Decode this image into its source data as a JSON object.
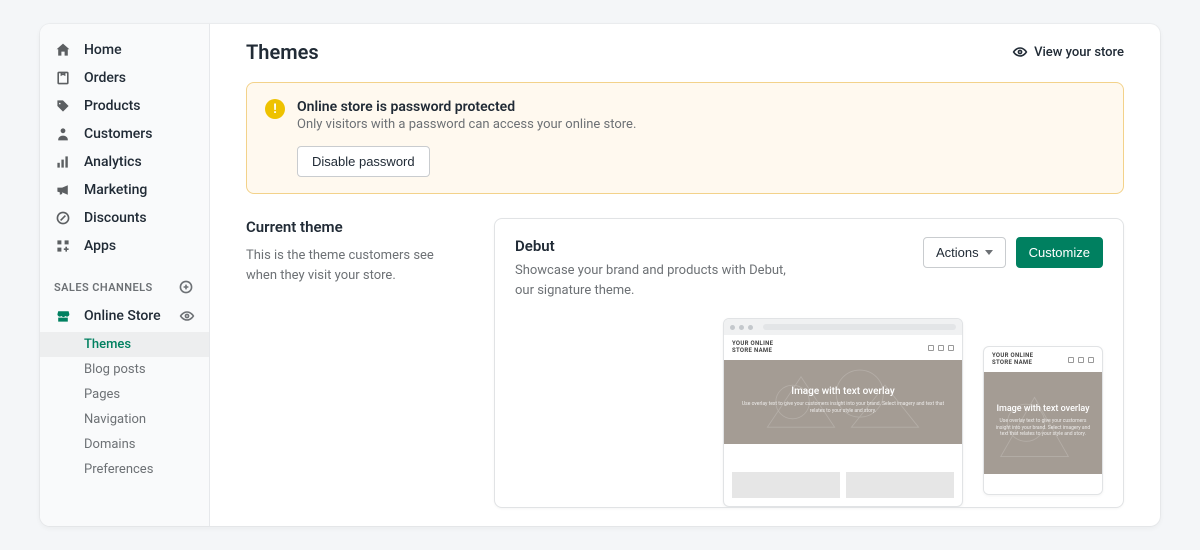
{
  "sidebar": {
    "items": [
      {
        "label": "Home"
      },
      {
        "label": "Orders"
      },
      {
        "label": "Products"
      },
      {
        "label": "Customers"
      },
      {
        "label": "Analytics"
      },
      {
        "label": "Marketing"
      },
      {
        "label": "Discounts"
      },
      {
        "label": "Apps"
      }
    ],
    "channels_heading": "SALES CHANNELS",
    "channel": {
      "label": "Online Store"
    },
    "sub_items": [
      {
        "label": "Themes",
        "active": true
      },
      {
        "label": "Blog posts"
      },
      {
        "label": "Pages"
      },
      {
        "label": "Navigation"
      },
      {
        "label": "Domains"
      },
      {
        "label": "Preferences"
      }
    ]
  },
  "header": {
    "title": "Themes",
    "view_store": "View your store"
  },
  "banner": {
    "title": "Online store is password protected",
    "desc": "Only visitors with a password can access your online store.",
    "button": "Disable password"
  },
  "current": {
    "heading": "Current theme",
    "desc": "This is the theme customers see when they visit your store."
  },
  "theme": {
    "name": "Debut",
    "desc": "Showcase your brand and products with Debut, our signature theme.",
    "actions_label": "Actions",
    "customize_label": "Customize"
  },
  "preview": {
    "brand": "YOUR ONLINE STORE NAME",
    "hero_title": "Image with text overlay",
    "hero_sub_desktop": "Use overlay text to give your customers insight into your brand. Select imagery and text that relates to your style and story.",
    "hero_sub_mobile": "Use overlay text to give your customers insight into your brand. Select imagery and text that relates to your style and story."
  }
}
